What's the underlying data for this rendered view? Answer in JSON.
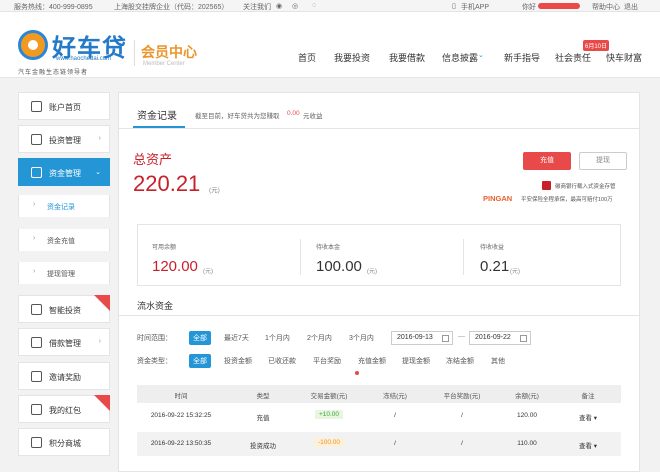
{
  "topbar": {
    "hotline": "服务热线：400-999-0895",
    "listed": "上海股交挂牌企业（代码：202565）",
    "follow": "关注我们",
    "mobile_app": "手机APP",
    "greeting": "你好",
    "help": "帮助中心",
    "logout": "退出"
  },
  "brand": {
    "name": "好车贷",
    "url": "www.haochedai.com",
    "slogan": "汽车金融生态链领导者",
    "member_title": "会员中心",
    "member_sub": "Member Center"
  },
  "nav": {
    "items": [
      {
        "label": "首页"
      },
      {
        "label": "我要投资"
      },
      {
        "label": "我要借款"
      },
      {
        "label": "信息披露"
      },
      {
        "label": "新手指导"
      },
      {
        "label": "社会责任"
      },
      {
        "label": "快车财富"
      }
    ],
    "badge": "6月10日"
  },
  "sidebar": {
    "items": [
      {
        "label": "账户首页"
      },
      {
        "label": "投资管理"
      },
      {
        "label": "资金管理"
      },
      {
        "label": "智能投资"
      },
      {
        "label": "借款管理"
      },
      {
        "label": "邀请奖励"
      },
      {
        "label": "我的红包"
      },
      {
        "label": "积分商城"
      }
    ],
    "sub_items": [
      {
        "label": "资金记录"
      },
      {
        "label": "资金充值"
      },
      {
        "label": "提现管理"
      }
    ]
  },
  "main": {
    "tab": "资金记录",
    "income_prefix": "截至目前，好车贷共为您赚取",
    "income_value": "0.00",
    "income_suffix": "元收益",
    "total_label": "总资产",
    "total_value": "220.21",
    "unit": "(元)",
    "charge_btn": "充值",
    "withdraw_btn": "提现",
    "bank_note": "徽商银行载入式资金存管",
    "pingan_brand": "PINGAN",
    "pingan_note": "平安保险全程承保，最高可赔付100万",
    "stats": [
      {
        "label": "可用余额",
        "value": "120.00",
        "unit": "(元)",
        "color": "#c8202b"
      },
      {
        "label": "待收本金",
        "value": "100.00",
        "unit": "(元)",
        "color": "#333333"
      },
      {
        "label": "待收收益",
        "value": "0.21",
        "unit": "(元)",
        "color": "#333333"
      }
    ],
    "section_title": "流水资金",
    "time_label": "时间范围：",
    "time_options": [
      "全部",
      "最近7天",
      "1个月内",
      "2个月内",
      "3个月内"
    ],
    "date_from": "2016-09-13",
    "date_to": "2016-09-22",
    "date_sep": "—",
    "type_label": "资金类型：",
    "type_options": [
      "全部",
      "投资金额",
      "已收还款",
      "平台奖励",
      "充值金额",
      "提现金额",
      "冻结金额",
      "其他"
    ],
    "table": {
      "headers": [
        "时间",
        "类型",
        "交易金额(元)",
        "冻结(元)",
        "平台奖励(元)",
        "余额(元)",
        "备注"
      ],
      "rows": [
        [
          "2016-09-22 15:32:25",
          "充值",
          "+10.00",
          "/",
          "/",
          "120.00",
          "查看 ▾"
        ],
        [
          "2016-09-22 13:50:35",
          "投资成功",
          "-100.00",
          "/",
          "/",
          "110.00",
          "查看 ▾"
        ]
      ]
    }
  }
}
